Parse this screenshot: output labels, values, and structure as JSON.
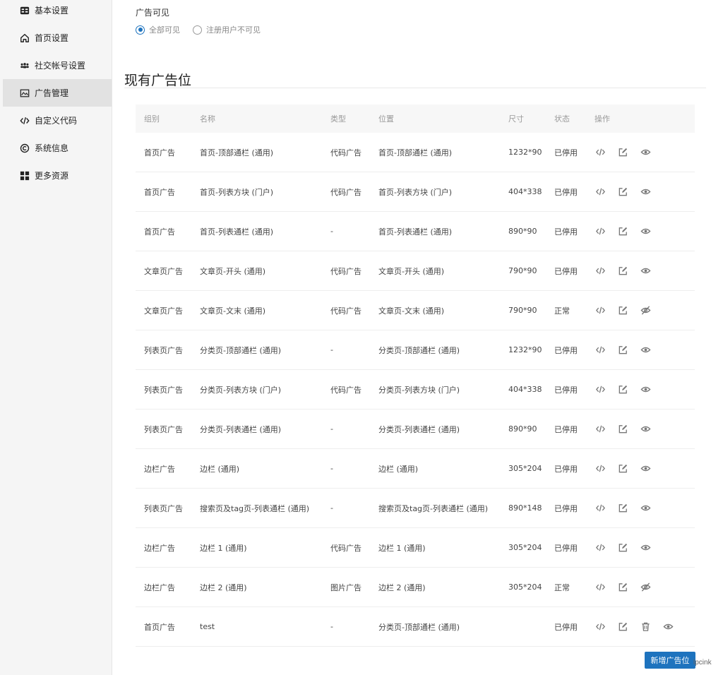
{
  "sidebar": {
    "items": [
      {
        "label": "基本设置",
        "icon": "settings-icon"
      },
      {
        "label": "首页设置",
        "icon": "home-icon"
      },
      {
        "label": "社交帐号设置",
        "icon": "users-icon"
      },
      {
        "label": "广告管理",
        "icon": "image-icon"
      },
      {
        "label": "自定义代码",
        "icon": "code-icon"
      },
      {
        "label": "系统信息",
        "icon": "copyright-icon"
      },
      {
        "label": "更多资源",
        "icon": "grid-icon"
      }
    ],
    "active_index": 3
  },
  "visibility": {
    "label": "广告可见",
    "options": [
      "全部可见",
      "注册用户不可见"
    ],
    "selected": 0
  },
  "section_title": "现有广告位",
  "table": {
    "headers": {
      "group": "组别",
      "name": "名称",
      "type": "类型",
      "position": "位置",
      "size": "尺寸",
      "status": "状态",
      "ops": "操作"
    },
    "rows": [
      {
        "group": "首页广告",
        "name": "首页-顶部通栏 (通用)",
        "type": "代码广告",
        "position": "首页-顶部通栏 (通用)",
        "size": "1232*90",
        "status": "已停用",
        "visibility_icon": "eye-icon"
      },
      {
        "group": "首页广告",
        "name": "首页-列表方块 (门户)",
        "type": "代码广告",
        "position": "首页-列表方块 (门户)",
        "size": "404*338",
        "status": "已停用",
        "visibility_icon": "eye-icon"
      },
      {
        "group": "首页广告",
        "name": "首页-列表通栏 (通用)",
        "type": "-",
        "position": "首页-列表通栏 (通用)",
        "size": "890*90",
        "status": "已停用",
        "visibility_icon": "eye-icon"
      },
      {
        "group": "文章页广告",
        "name": "文章页-开头 (通用)",
        "type": "代码广告",
        "position": "文章页-开头 (通用)",
        "size": "790*90",
        "status": "已停用",
        "visibility_icon": "eye-icon"
      },
      {
        "group": "文章页广告",
        "name": "文章页-文末 (通用)",
        "type": "代码广告",
        "position": "文章页-文末 (通用)",
        "size": "790*90",
        "status": "正常",
        "visibility_icon": "eye-off-icon"
      },
      {
        "group": "列表页广告",
        "name": "分类页-顶部通栏 (通用)",
        "type": "-",
        "position": "分类页-顶部通栏 (通用)",
        "size": "1232*90",
        "status": "已停用",
        "visibility_icon": "eye-icon"
      },
      {
        "group": "列表页广告",
        "name": "分类页-列表方块 (门户)",
        "type": "代码广告",
        "position": "分类页-列表方块 (门户)",
        "size": "404*338",
        "status": "已停用",
        "visibility_icon": "eye-icon"
      },
      {
        "group": "列表页广告",
        "name": "分类页-列表通栏 (通用)",
        "type": "-",
        "position": "分类页-列表通栏 (通用)",
        "size": "890*90",
        "status": "已停用",
        "visibility_icon": "eye-icon"
      },
      {
        "group": "边栏广告",
        "name": "边栏 (通用)",
        "type": "-",
        "position": "边栏 (通用)",
        "size": "305*204",
        "status": "已停用",
        "visibility_icon": "eye-icon"
      },
      {
        "group": "列表页广告",
        "name": "搜索页及tag页-列表通栏 (通用)",
        "type": "-",
        "position": "搜索页及tag页-列表通栏 (通用)",
        "size": "890*148",
        "status": "已停用",
        "visibility_icon": "eye-icon"
      },
      {
        "group": "边栏广告",
        "name": "边栏 1 (通用)",
        "type": "代码广告",
        "position": "边栏 1 (通用)",
        "size": "305*204",
        "status": "已停用",
        "visibility_icon": "eye-icon"
      },
      {
        "group": "边栏广告",
        "name": "边栏 2 (通用)",
        "type": "图片广告",
        "position": "边栏 2 (通用)",
        "size": "305*204",
        "status": "正常",
        "visibility_icon": "eye-off-icon"
      },
      {
        "group": "首页广告",
        "name": "test",
        "type": "-",
        "position": "分类页-顶部通栏 (通用)",
        "size": "",
        "status": "已停用",
        "visibility_icon": "eye-icon",
        "deletable": true
      }
    ]
  },
  "add_button_label": "新增广告位",
  "watermark": "lpcink",
  "colors": {
    "accent": "#1e73be",
    "icon": "#777777"
  }
}
